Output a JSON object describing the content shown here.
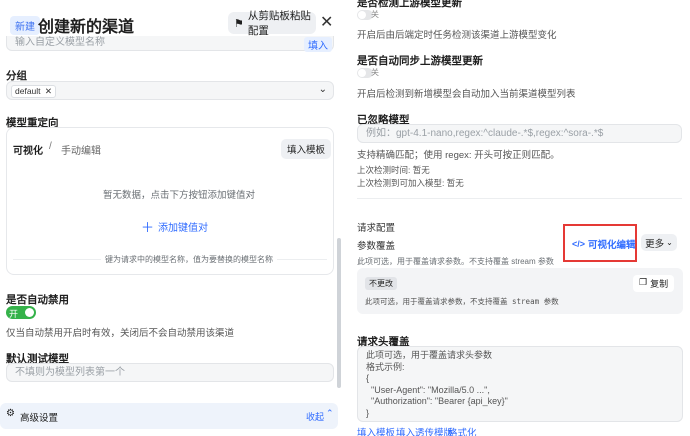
{
  "header": {
    "badge": "新建",
    "title": "创建新的渠道",
    "paste_label": "从剪贴板粘贴配置"
  },
  "custom_model": {
    "placeholder": "输入自定义模型名称",
    "fill_label": "填入"
  },
  "group": {
    "label": "分组",
    "chip": "default"
  },
  "redirect": {
    "label": "模型重定向",
    "tab_visual": "可视化",
    "separator": "/",
    "tab_manual": "手动编辑",
    "fill_template": "填入模板",
    "empty_text": "暂无数据，点击下方按钮添加键值对",
    "add_label": "添加键值对",
    "hint": "键为请求中的模型名称，值为要替换的模型名称"
  },
  "auto_disable": {
    "label": "是否自动禁用",
    "toggle_text": "开",
    "desc": "仅当自动禁用开启时有效，关闭后不会自动禁用该渠道"
  },
  "test_model": {
    "label": "默认测试模型",
    "placeholder": "不填则为模型列表第一个"
  },
  "advanced": {
    "label": "高级设置",
    "collapse": "收起"
  },
  "right": {
    "upstream_update_label": "是否检测上游模型更新",
    "toggle1_text": "关",
    "upstream_update_desc": "开启后由后端定时任务检测该渠道上游模型变化",
    "sync_label": "是否自动同步上游模型更新",
    "toggle2_text": "关",
    "sync_desc": "开启后检测到新增模型会自动加入当前渠道模型列表",
    "ignored_label": "已忽略模型",
    "ignored_placeholder": "例如：gpt-4.1-nano,regex:^claude-.*$,regex:^sora-.*$",
    "ignored_desc": "支持精确匹配；使用 regex: 开头可按正则匹配。",
    "last_check": "上次检测时间: 暂无",
    "last_addable": "上次检测到可加入模型: 暂无",
    "request_config": "请求配置",
    "param_override": "参数覆盖",
    "visual_edit": "可视化编辑",
    "more": "更多",
    "param_desc": "此项可选，用于覆盖请求参数。不支持覆盖 stream 参数",
    "unchanged_badge": "不更改",
    "copy_label": "复制",
    "param_code_desc": "此项可选，用于覆盖请求参数，不支持覆盖 stream 参数",
    "header_override": "请求头覆盖",
    "header_lines": [
      "此项可选，用于覆盖请求头参数",
      "格式示例:",
      "{",
      "  \"User-Agent\": \"Mozilla/5.0 ...\",",
      "  \"Authorization\": \"Bearer {api_key}\"",
      "}"
    ],
    "link_fill_template": "填入模板",
    "link_passthrough": "填入透传模版",
    "link_format": "格式化"
  },
  "colors": {
    "accent": "#2f6bff",
    "toggle_on": "#35b24a",
    "highlight": "#e53935"
  }
}
